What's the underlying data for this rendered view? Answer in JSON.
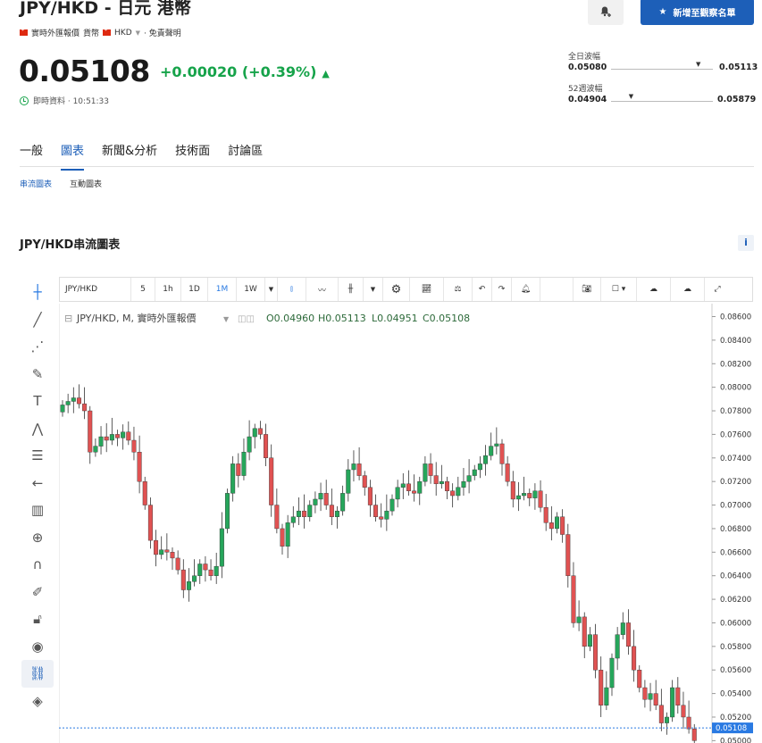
{
  "header": {
    "title": "JPY/HKD - 日元 港幣",
    "meta_source": "實時外匯報價",
    "meta_currency_label": "貨幣",
    "meta_currency_code": "HKD",
    "meta_disclaimer": "免責聲明",
    "price": "0.05108",
    "change": "+0.00020 (+0.39%)",
    "realtime_label": "即時資料 · 10:51:33",
    "alert_button": "bell-plus-icon",
    "watchlist_button_label": "新增至觀察名單",
    "colors": {
      "up": "#16a34a",
      "accent": "#1d5fb8"
    }
  },
  "ranges": {
    "day_label": "全日波幅",
    "day_low": "0.05080",
    "day_high": "0.05113",
    "day_position": 0.86,
    "week52_label": "52週波幅",
    "week52_low": "0.04904",
    "week52_high": "0.05879",
    "week52_position": 0.2
  },
  "tabs": [
    "一般",
    "圖表",
    "新聞&分析",
    "技術面",
    "討論區"
  ],
  "active_tab": "圖表",
  "subtabs": [
    "串流圖表",
    "互動圖表"
  ],
  "section_title": "JPY/HKD串流圖表",
  "info_label": "i",
  "toolbar": {
    "symbol": "JPY/HKD",
    "intervals": [
      "5",
      "1h",
      "1D",
      "1M",
      "1W"
    ],
    "active_interval": "1M"
  },
  "chart_data": {
    "type": "candlestick",
    "legend": {
      "title": "JPY/HKD, M, 實時外匯報價",
      "open": "O0.04960",
      "high": "H0.05113",
      "low": "L0.04951",
      "close": "C0.05108"
    },
    "ylim": [
      0.0498,
      0.0871
    ],
    "y_ticks": [
      "0.08600",
      "0.08400",
      "0.08200",
      "0.08000",
      "0.07800",
      "0.07600",
      "0.07400",
      "0.07200",
      "0.07000",
      "0.06800",
      "0.06600",
      "0.06400",
      "0.06200",
      "0.06000",
      "0.05800",
      "0.05600",
      "0.05400",
      "0.05200",
      "0.05000"
    ],
    "last_price_label": "0.05108",
    "last_price": 0.05108,
    "up_color": "#26a65b",
    "down_color": "#e05252"
  }
}
